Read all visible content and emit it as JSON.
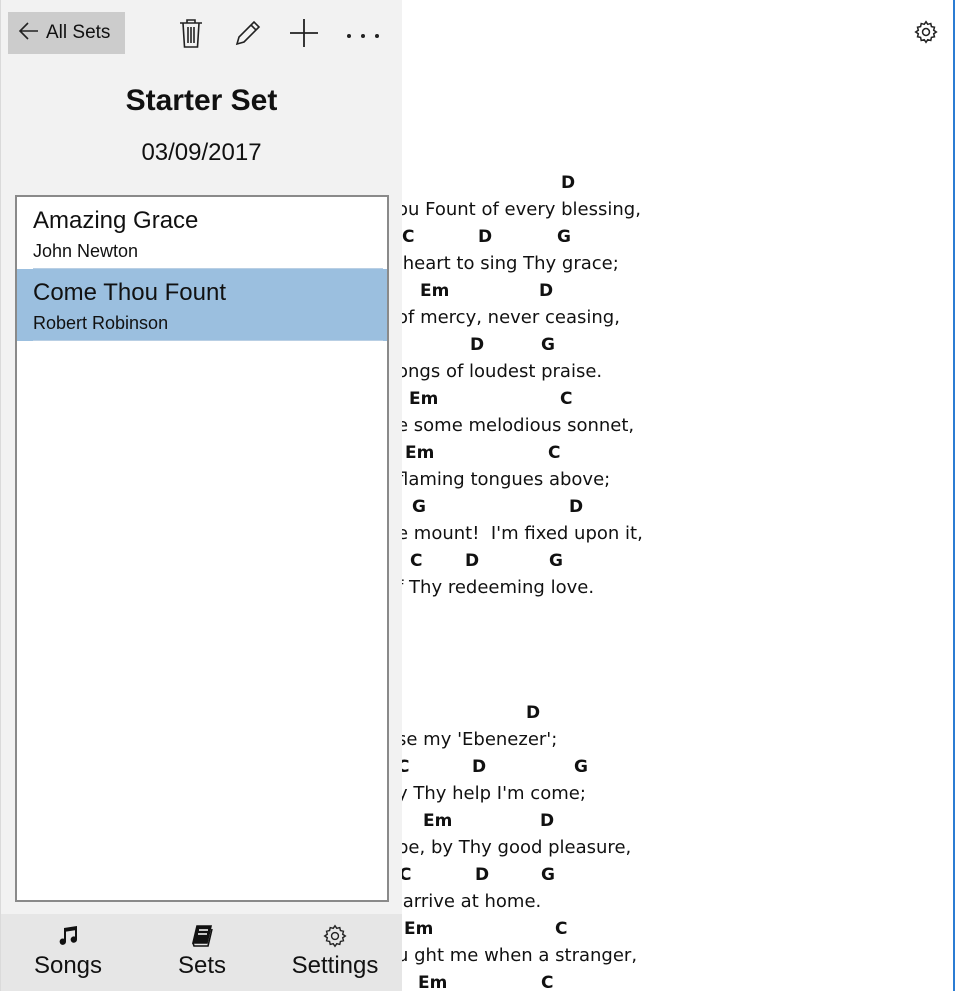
{
  "toolbar": {
    "back_label": "All Sets",
    "back_icon": "arrow-left-icon",
    "delete_icon": "trash-icon",
    "edit_icon": "pencil-icon",
    "add_icon": "plus-icon",
    "more_icon": "more-icon"
  },
  "set": {
    "title": "Starter Set",
    "date": "03/09/2017"
  },
  "songs": [
    {
      "name": "Amazing Grace",
      "author": "John Newton",
      "selected": false
    },
    {
      "name": "Come Thou Fount",
      "author": "Robert Robinson",
      "selected": true
    }
  ],
  "nav": {
    "songs_label": "Songs",
    "sets_label": "Sets",
    "settings_label": "Settings"
  },
  "lyrics": {
    "verse1": [
      {
        "chords": [
          "D"
        ],
        "text": "ou Fount of every blessing,"
      },
      {
        "chords": [
          "C",
          "D",
          "G"
        ],
        "text": " heart to sing Thy grace;"
      },
      {
        "chords": [
          "Em",
          "D"
        ],
        "text": "of mercy, never ceasing,"
      },
      {
        "chords": [
          "D",
          "G"
        ],
        "text": "ongs of loudest praise."
      },
      {
        "chords": [
          "Em",
          "C"
        ],
        "text": "e some melodious sonnet,"
      },
      {
        "chords": [
          "Em",
          "C"
        ],
        "text": "flaming tongues above;"
      },
      {
        "chords": [
          "G",
          "D"
        ],
        "text": "e mount!  I'm fixed upon it,"
      },
      {
        "chords": [
          "C",
          "D",
          "G"
        ],
        "text": "f Thy redeeming love."
      }
    ],
    "verse2": [
      {
        "chords": [
          "D"
        ],
        "text": "se my 'Ebenezer';"
      },
      {
        "chords": [
          "C",
          "D",
          "G"
        ],
        "text": "y Thy help I'm come;"
      },
      {
        "chords": [
          "Em",
          "D"
        ],
        "text": "pe, by Thy good pleasure,"
      },
      {
        "chords": [
          "C",
          "D",
          "G"
        ],
        "text": " arrive at home."
      },
      {
        "chords": [
          "Em",
          "C"
        ],
        "text": "u ght me when a stranger,"
      },
      {
        "chords": [
          "Em",
          "C"
        ],
        "text": ""
      }
    ]
  },
  "colors": {
    "pane_bg": "#f2f2f2",
    "selected_bg": "#9bbfdf",
    "back_button_bg": "#cccccc",
    "accent": "#2b7cd3"
  }
}
